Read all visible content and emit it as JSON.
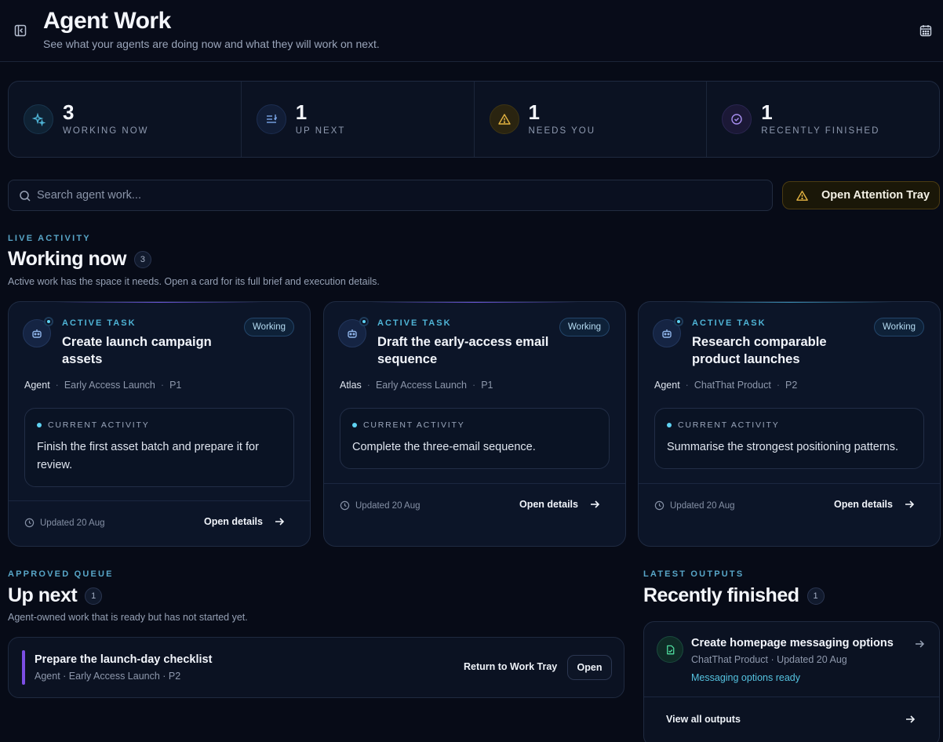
{
  "header": {
    "title": "Agent Work",
    "subtitle": "See what your agents are doing now and what they will work on next."
  },
  "stats": [
    {
      "value": "3",
      "label": "WORKING NOW",
      "icon": "sparkle-icon",
      "color": "#4fb4d6"
    },
    {
      "value": "1",
      "label": "UP NEXT",
      "icon": "list-icon",
      "color": "#7aa6e8"
    },
    {
      "value": "1",
      "label": "NEEDS YOU",
      "icon": "warning-icon",
      "color": "#e3b341"
    },
    {
      "value": "1",
      "label": "RECENTLY FINISHED",
      "icon": "check-circle-icon",
      "color": "#a88ef0"
    }
  ],
  "search": {
    "placeholder": "Search agent work..."
  },
  "attention_button": {
    "label": "Open Attention Tray"
  },
  "working_now": {
    "eyebrow": "LIVE ACTIVITY",
    "title": "Working now",
    "count": "3",
    "description": "Active work has the space it needs. Open a card for its full brief and execution details.",
    "cards": [
      {
        "eyebrow": "ACTIVE TASK",
        "title": "Create launch campaign assets",
        "status": "Working",
        "agent": "Agent",
        "project": "Early Access Launch",
        "priority": "P1",
        "activity_label": "CURRENT ACTIVITY",
        "activity": "Finish the first asset batch and prepare it for review.",
        "updated": "Updated 20 Aug",
        "action": "Open details"
      },
      {
        "eyebrow": "ACTIVE TASK",
        "title": "Draft the early-access email sequence",
        "status": "Working",
        "agent": "Atlas",
        "project": "Early Access Launch",
        "priority": "P1",
        "activity_label": "CURRENT ACTIVITY",
        "activity": "Complete the three-email sequence.",
        "updated": "Updated 20 Aug",
        "action": "Open details"
      },
      {
        "eyebrow": "ACTIVE TASK",
        "title": "Research comparable product launches",
        "status": "Working",
        "agent": "Agent",
        "project": "ChatThat Product",
        "priority": "P2",
        "activity_label": "CURRENT ACTIVITY",
        "activity": "Summarise the strongest positioning patterns.",
        "updated": "Updated 20 Aug",
        "action": "Open details"
      }
    ]
  },
  "up_next": {
    "eyebrow": "APPROVED QUEUE",
    "title": "Up next",
    "count": "1",
    "description": "Agent-owned work that is ready but has not started yet.",
    "item": {
      "title": "Prepare the launch-day checklist",
      "meta": "Agent · Early Access Launch · P2",
      "return_label": "Return to Work Tray",
      "open_label": "Open",
      "accent": "#7c4ee4"
    }
  },
  "recently_finished": {
    "eyebrow": "LATEST OUTPUTS",
    "title": "Recently finished",
    "count": "1",
    "item": {
      "title": "Create homepage messaging options",
      "meta": "ChatThat Product · Updated 20 Aug",
      "status": "Messaging options ready"
    },
    "view_all": "View all outputs"
  }
}
